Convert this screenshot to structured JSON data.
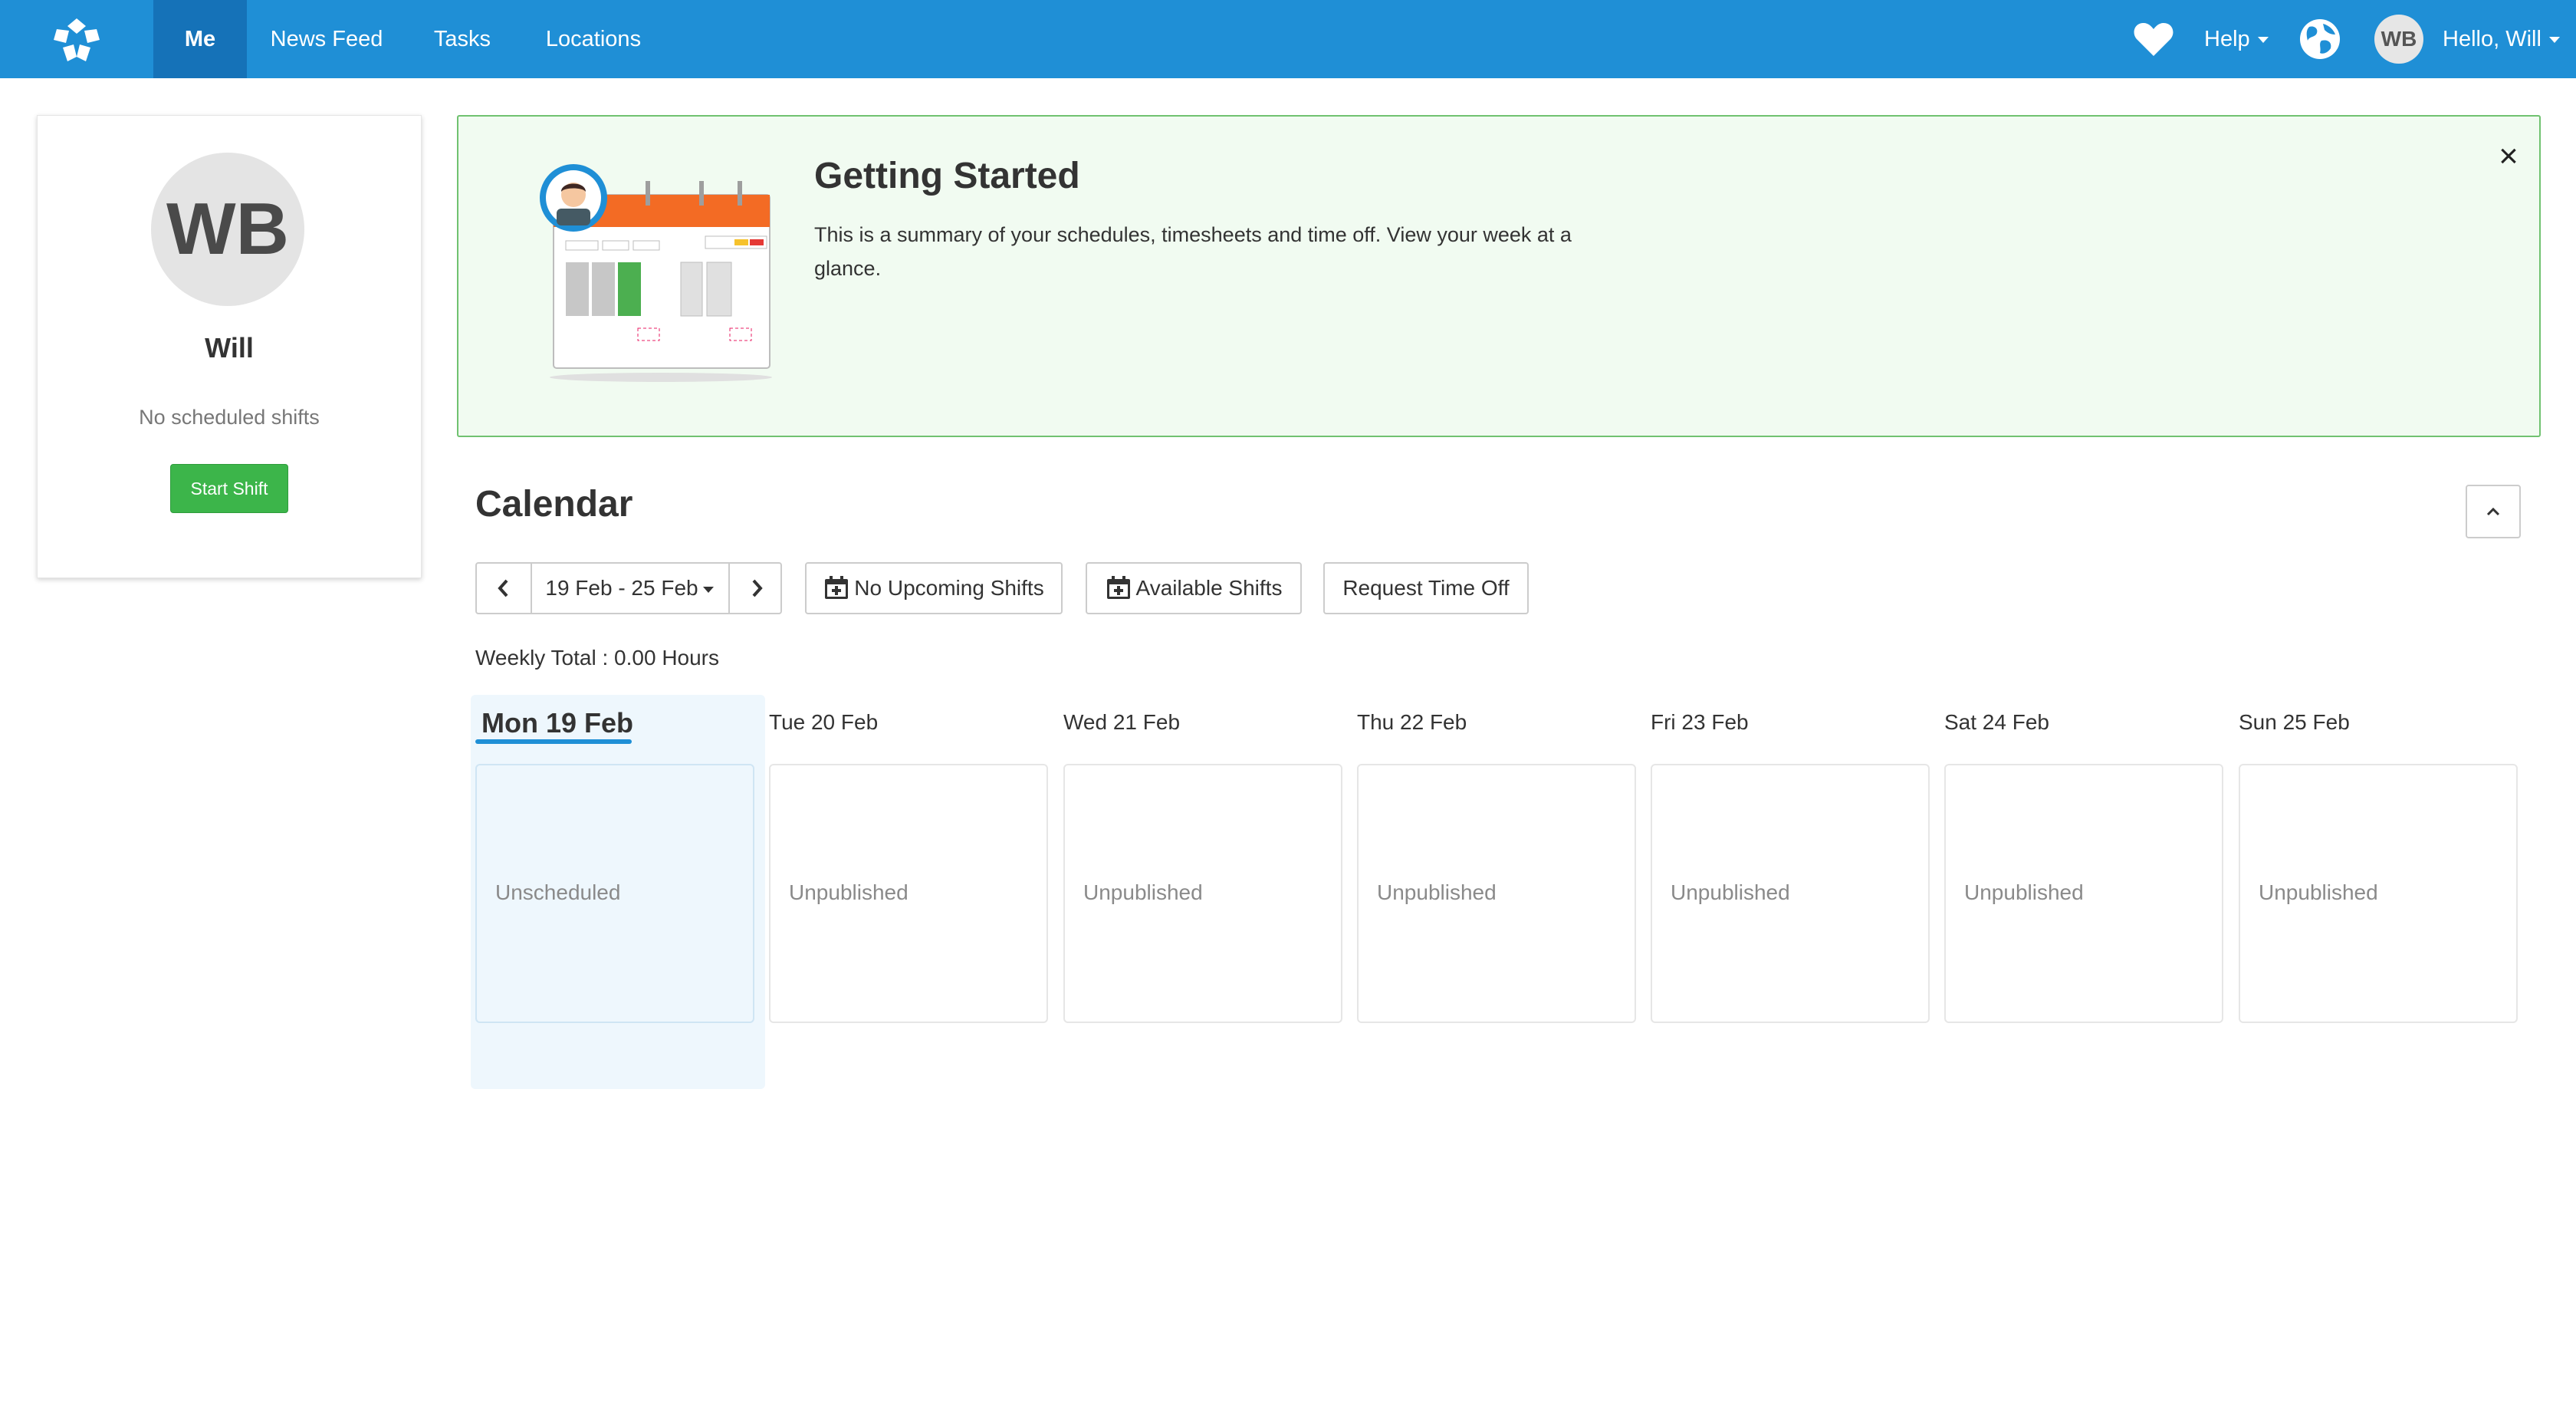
{
  "nav": {
    "items": [
      {
        "label": "Me",
        "active": true
      },
      {
        "label": "News Feed",
        "active": false
      },
      {
        "label": "Tasks",
        "active": false
      },
      {
        "label": "Locations",
        "active": false
      }
    ],
    "help_label": "Help",
    "avatar_initials": "WB",
    "hello_label": "Hello, Will",
    "bar_color": "#1f8fd6"
  },
  "profile": {
    "initials": "WB",
    "name": "Will",
    "shifts_text": "No scheduled shifts",
    "start_shift_label": "Start Shift"
  },
  "getting_started": {
    "title": "Getting Started",
    "text": "This is a summary of your schedules, timesheets and time off. View your week at a glance.",
    "close_label": "×"
  },
  "calendar": {
    "title": "Calendar",
    "range_label": "19 Feb - 25 Feb",
    "upcoming_label": "No Upcoming Shifts",
    "available_label": "Available Shifts",
    "time_off_label": "Request Time Off",
    "weekly_total": "Weekly Total : 0.00 Hours",
    "days": [
      {
        "label": "Mon 19 Feb",
        "status": "Unscheduled",
        "today": true
      },
      {
        "label": "Tue 20 Feb",
        "status": "Unpublished"
      },
      {
        "label": "Wed 21 Feb",
        "status": "Unpublished"
      },
      {
        "label": "Thu 22 Feb",
        "status": "Unpublished"
      },
      {
        "label": "Fri 23 Feb",
        "status": "Unpublished"
      },
      {
        "label": "Sat 24 Feb",
        "status": "Unpublished"
      },
      {
        "label": "Sun 25 Feb",
        "status": "Unpublished"
      }
    ]
  }
}
